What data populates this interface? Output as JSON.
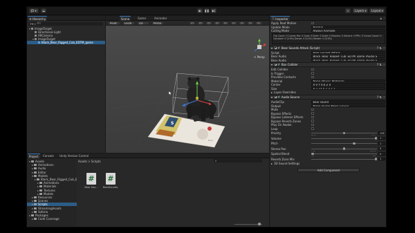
{
  "topbar": {
    "account": "JD",
    "cloud_icon": "cloud-icon",
    "play_icon": "play-icon",
    "pause_icon": "pause-icon",
    "step_icon": "step-icon",
    "layers": "Layers",
    "layout": "Layout"
  },
  "hierarchy": {
    "tab": "Hierarchy",
    "search_placeholder": "All",
    "items": [
      {
        "label": "ImageTarget",
        "depth": 0,
        "icon": "scene",
        "expanded": true
      },
      {
        "label": "Directional Light",
        "depth": 1,
        "icon": "cube"
      },
      {
        "label": "ARCamera",
        "depth": 1,
        "icon": "cube"
      },
      {
        "label": "ImageTarget",
        "depth": 1,
        "icon": "cube",
        "expanded": true
      },
      {
        "label": "Black_Bear_Rigged_Cub_EDTM_game",
        "depth": 2,
        "icon": "cube-blue",
        "selected": true
      }
    ]
  },
  "scene": {
    "tabs": [
      "Scene",
      "Game",
      "Animator"
    ],
    "active_tab": 0,
    "toolbar_items": [
      "Pivot",
      "Local",
      "2D",
      "Persp"
    ],
    "persp_label": "< Persp",
    "target_card_text": "Bear"
  },
  "inspector": {
    "tab": "Inspector",
    "header_rows": [
      {
        "label": "Apply Root Motion",
        "value": ""
      },
      {
        "label": "Update Mode",
        "value": "Normal"
      },
      {
        "label": "Culling Mode",
        "value": "Always Animate"
      }
    ],
    "info_text": "Clip Count: 0  Curves Pos: 0 Quat: 0 Euler: 0 Scale: 0 Muscles: 0 Generic: 0 PPtr: 0  Curves Count: 0 Constant: 0 (0.0%) Dense: 0 (0.0%) Stream: 0 (0.0%)",
    "components": [
      {
        "title": "Bear Sounds Attack (Script)",
        "rows": [
          {
            "label": "Script",
            "value": "Bear Sounds Attack"
          },
          {
            "label": "Bear Audio",
            "value": "Black_Bear_Rigged_Cub_EDTM_game (Audio S"
          },
          {
            "label": "Bear Audio",
            "value": "Black_Bear_Rigged_Cub_EDTM_game (Audio S"
          }
        ]
      },
      {
        "title": "Box Collider",
        "rows": [
          {
            "label": "Edit Collider",
            "value": ""
          },
          {
            "label": "Is Trigger",
            "value": "",
            "check": false
          },
          {
            "label": "Provides Contacts",
            "value": "",
            "check": false
          },
          {
            "label": "Material",
            "value": "None (Physic Material)"
          },
          {
            "label": "Center",
            "value": "X 0   Y 0.6   Z 0"
          },
          {
            "label": "Size",
            "value": "X 2.37  Y 2.3  Z 1"
          }
        ],
        "foldout": "Layer Overrides"
      },
      {
        "title": "Audio Source",
        "rows": [
          {
            "label": "AudioClip",
            "value": "bear sound"
          },
          {
            "label": "Output",
            "value": "None (Audio Mixer Group)"
          },
          {
            "label": "Mute",
            "value": "",
            "check": false
          },
          {
            "label": "Bypass Effects",
            "value": "",
            "check": false
          },
          {
            "label": "Bypass Listener Effects",
            "value": "",
            "check": false
          },
          {
            "label": "Bypass Reverb Zones",
            "value": "",
            "check": false
          },
          {
            "label": "Play On Awake",
            "value": "",
            "check": false
          },
          {
            "label": "Loop",
            "value": "",
            "check": false
          }
        ],
        "sliders": [
          {
            "label": "Priority",
            "value": 128,
            "fraction": 0.5,
            "left": "High",
            "right": "Low"
          },
          {
            "label": "Volume",
            "value": 1,
            "fraction": 1.0
          },
          {
            "label": "Pitch",
            "value": 1,
            "fraction": 0.66
          },
          {
            "label": "Stereo Pan",
            "value": 0,
            "fraction": 0.5,
            "left": "Left",
            "right": "Right"
          },
          {
            "label": "Spatial Blend",
            "value": 0,
            "fraction": 0.0,
            "left": "2D",
            "right": "3D"
          },
          {
            "label": "Reverb Zone Mix",
            "value": 1,
            "fraction": 1.0
          }
        ],
        "foldout": "3D Sound Settings"
      }
    ],
    "add_component": "Add Component"
  },
  "project": {
    "tabs": [
      "Project",
      "Console",
      "Unity Version Control"
    ],
    "breadcrumb": "Assets > Scripts",
    "tree": [
      {
        "label": "Assets",
        "depth": 0,
        "open": true
      },
      {
        "label": "Animations",
        "depth": 1
      },
      {
        "label": "Audio",
        "depth": 1
      },
      {
        "label": "Editor",
        "depth": 1
      },
      {
        "label": "Models",
        "depth": 1,
        "open": true
      },
      {
        "label": "Black_Bear_Rigged_Cub_EDTM_game",
        "depth": 2
      },
      {
        "label": "Animations",
        "depth": 3
      },
      {
        "label": "Materials",
        "depth": 3
      },
      {
        "label": "Textures",
        "depth": 3
      },
      {
        "label": "Models",
        "depth": 3
      },
      {
        "label": "Resources",
        "depth": 1
      },
      {
        "label": "Scenes",
        "depth": 1
      },
      {
        "label": "Scripts",
        "depth": 1,
        "selected": true
      },
      {
        "label": "StreamingAssets",
        "depth": 1
      },
      {
        "label": "Vuforia",
        "depth": 1
      },
      {
        "label": "Packages",
        "depth": 0
      },
      {
        "label": "Code Coverage",
        "depth": 1
      }
    ],
    "assets": [
      {
        "label": "Bear Sou..."
      },
      {
        "label": "BearSounds..."
      }
    ]
  },
  "colors": {
    "accent": "#3a79bb",
    "selection": "#2c5d87",
    "panel": "#282828",
    "viewport": "#474747"
  }
}
